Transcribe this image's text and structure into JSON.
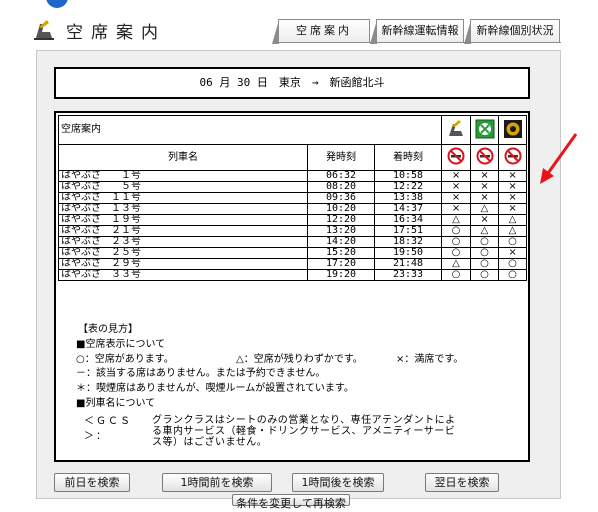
{
  "header": {
    "title": "空席案内",
    "tabs": [
      {
        "label": "空席案内"
      },
      {
        "label": "新幹線運転情報"
      },
      {
        "label": "新幹線個別状況"
      }
    ]
  },
  "route": {
    "text": "06 月 30 日　東京　→　新函館北斗"
  },
  "seat_table": {
    "title": "空席案内",
    "columns": [
      "列車名",
      "発時刻",
      "着時刻"
    ],
    "icon_columns": [
      "reserved-seat-icon",
      "green-car-icon",
      "gran-class-icon"
    ],
    "smoking_icons": [
      "no-smoking-icon",
      "no-smoking-icon",
      "no-smoking-icon"
    ],
    "rows": [
      {
        "train": "はやぶさ　　１号",
        "dep": "06:32",
        "arr": "10:58",
        "s1": "×",
        "s2": "×",
        "s3": "×"
      },
      {
        "train": "はやぶさ　　５号",
        "dep": "08:20",
        "arr": "12:22",
        "s1": "×",
        "s2": "×",
        "s3": "×"
      },
      {
        "train": "はやぶさ　１１号",
        "dep": "09:36",
        "arr": "13:38",
        "s1": "×",
        "s2": "×",
        "s3": "×"
      },
      {
        "train": "はやぶさ　１３号",
        "dep": "10:20",
        "arr": "14:37",
        "s1": "×",
        "s2": "△",
        "s3": "×"
      },
      {
        "train": "はやぶさ　１９号",
        "dep": "12:20",
        "arr": "16:34",
        "s1": "△",
        "s2": "×",
        "s3": "△"
      },
      {
        "train": "はやぶさ　２１号",
        "dep": "13:20",
        "arr": "17:51",
        "s1": "○",
        "s2": "△",
        "s3": "△"
      },
      {
        "train": "はやぶさ　２３号",
        "dep": "14:20",
        "arr": "18:32",
        "s1": "○",
        "s2": "○",
        "s3": "○"
      },
      {
        "train": "はやぶさ　２５号",
        "dep": "15:20",
        "arr": "19:50",
        "s1": "○",
        "s2": "○",
        "s3": "×"
      },
      {
        "train": "はやぶさ　２９号",
        "dep": "17:20",
        "arr": "21:48",
        "s1": "△",
        "s2": "○",
        "s3": "○"
      },
      {
        "train": "はやぶさ　３３号",
        "dep": "19:20",
        "arr": "23:33",
        "s1": "○",
        "s2": "○",
        "s3": "○"
      }
    ]
  },
  "legend": {
    "heading": "【表の見方】",
    "section1": "■空席表示について",
    "sym_available": "○：空席があります。",
    "sym_few": "△：空席が残りわずかです。",
    "sym_full": "×：満席です。",
    "line_none": "－：該当する席はありません。または予約できません。",
    "line_smoking": "＊：喫煙席はありませんが、喫煙ルームが設置されています。",
    "section2": "■列車名について",
    "gcs_label": "＜ＧＣＳ＞：",
    "gcs_text1": "グランクラスはシートのみの営業となり、専任アテンダントによ",
    "gcs_text2": "る車内サービス（軽食・ドリンクサービス、アメニティーサービ",
    "gcs_text3": "ス等）はございません。"
  },
  "buttons": {
    "prev_day": "前日を検索",
    "hour_before": "1時間前を検索",
    "hour_after": "1時間後を検索",
    "next_day": "翌日を検索",
    "partial": "条件を変更して再検索"
  },
  "colors": {
    "accent_blue": "#1e66c8",
    "arrow_red": "#e8141a",
    "green_car": "#2a9a3a",
    "no_smoking_red": "#d8151d"
  }
}
